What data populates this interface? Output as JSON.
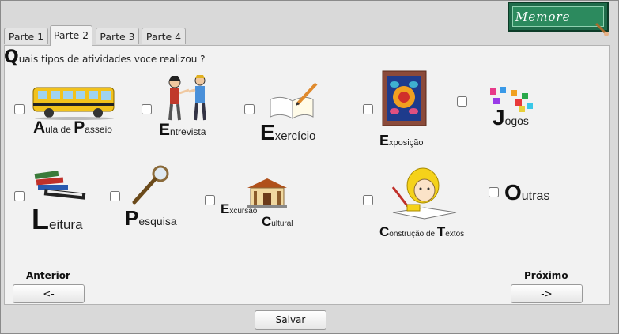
{
  "logo": {
    "text": "Memore"
  },
  "tabs": [
    {
      "label": "Parte 1",
      "active": false
    },
    {
      "label": "Parte 2",
      "active": true
    },
    {
      "label": "Parte 3",
      "active": false
    },
    {
      "label": "Parte 4",
      "active": false
    }
  ],
  "question": {
    "initial": "Q",
    "rest": "uais tipos de atividades voce realizou ?"
  },
  "activities": [
    {
      "id": "aula-de-passeio",
      "label": "Aula de Passeio",
      "checked": false,
      "icon": "school-bus-icon"
    },
    {
      "id": "entrevista",
      "label": "Entrevista",
      "checked": false,
      "icon": "interview-icon"
    },
    {
      "id": "exercicio",
      "label": "Exercício",
      "checked": false,
      "icon": "notebook-pencil-icon"
    },
    {
      "id": "exposicao",
      "label": "Exposição",
      "checked": false,
      "icon": "framed-art-icon"
    },
    {
      "id": "jogos",
      "label": "Jogos",
      "checked": false,
      "icon": "puzzle-icon"
    },
    {
      "id": "leitura",
      "label": "Leitura",
      "checked": false,
      "icon": "books-icon"
    },
    {
      "id": "pesquisa",
      "label": "Pesquisa",
      "checked": false,
      "icon": "magnifier-icon"
    },
    {
      "id": "excursao-cultural",
      "label": "Excursao Cultural",
      "checked": false,
      "icon": "museum-icon"
    },
    {
      "id": "construcao-de-textos",
      "label": "Construção de Textos",
      "checked": false,
      "icon": "child-writing-icon"
    },
    {
      "id": "outras",
      "label": "Outras",
      "checked": false,
      "icon": ""
    }
  ],
  "nav": {
    "prev_label": "Anterior",
    "prev_button": "<-",
    "next_label": "Próximo",
    "next_button": "->",
    "save_button": "Salvar"
  }
}
